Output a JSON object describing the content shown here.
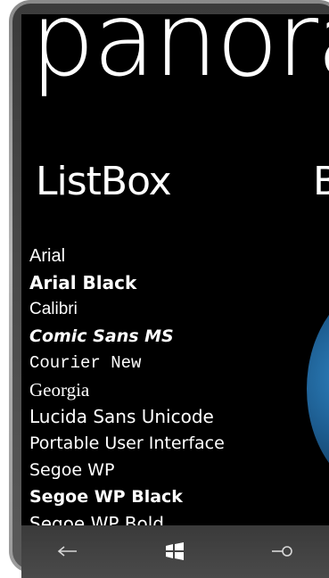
{
  "panorama": {
    "title": "panorama",
    "sections": [
      {
        "header": "ListBox"
      },
      {
        "header": "B"
      }
    ]
  },
  "listbox": {
    "items": [
      "Arial",
      "Arial Black",
      "Calibri",
      "Comic Sans MS",
      "Courier New",
      "Georgia",
      "Lucida Sans Unicode",
      "Portable User Interface",
      "Segoe WP",
      "Segoe WP Black",
      "Segoe WP Bold"
    ]
  },
  "navbar": {
    "buttons": [
      "back-icon",
      "windows-start-icon",
      "search-icon"
    ]
  },
  "colors": {
    "background": "#000000",
    "foreground": "#ffffff",
    "globe": "#1e5f93"
  }
}
